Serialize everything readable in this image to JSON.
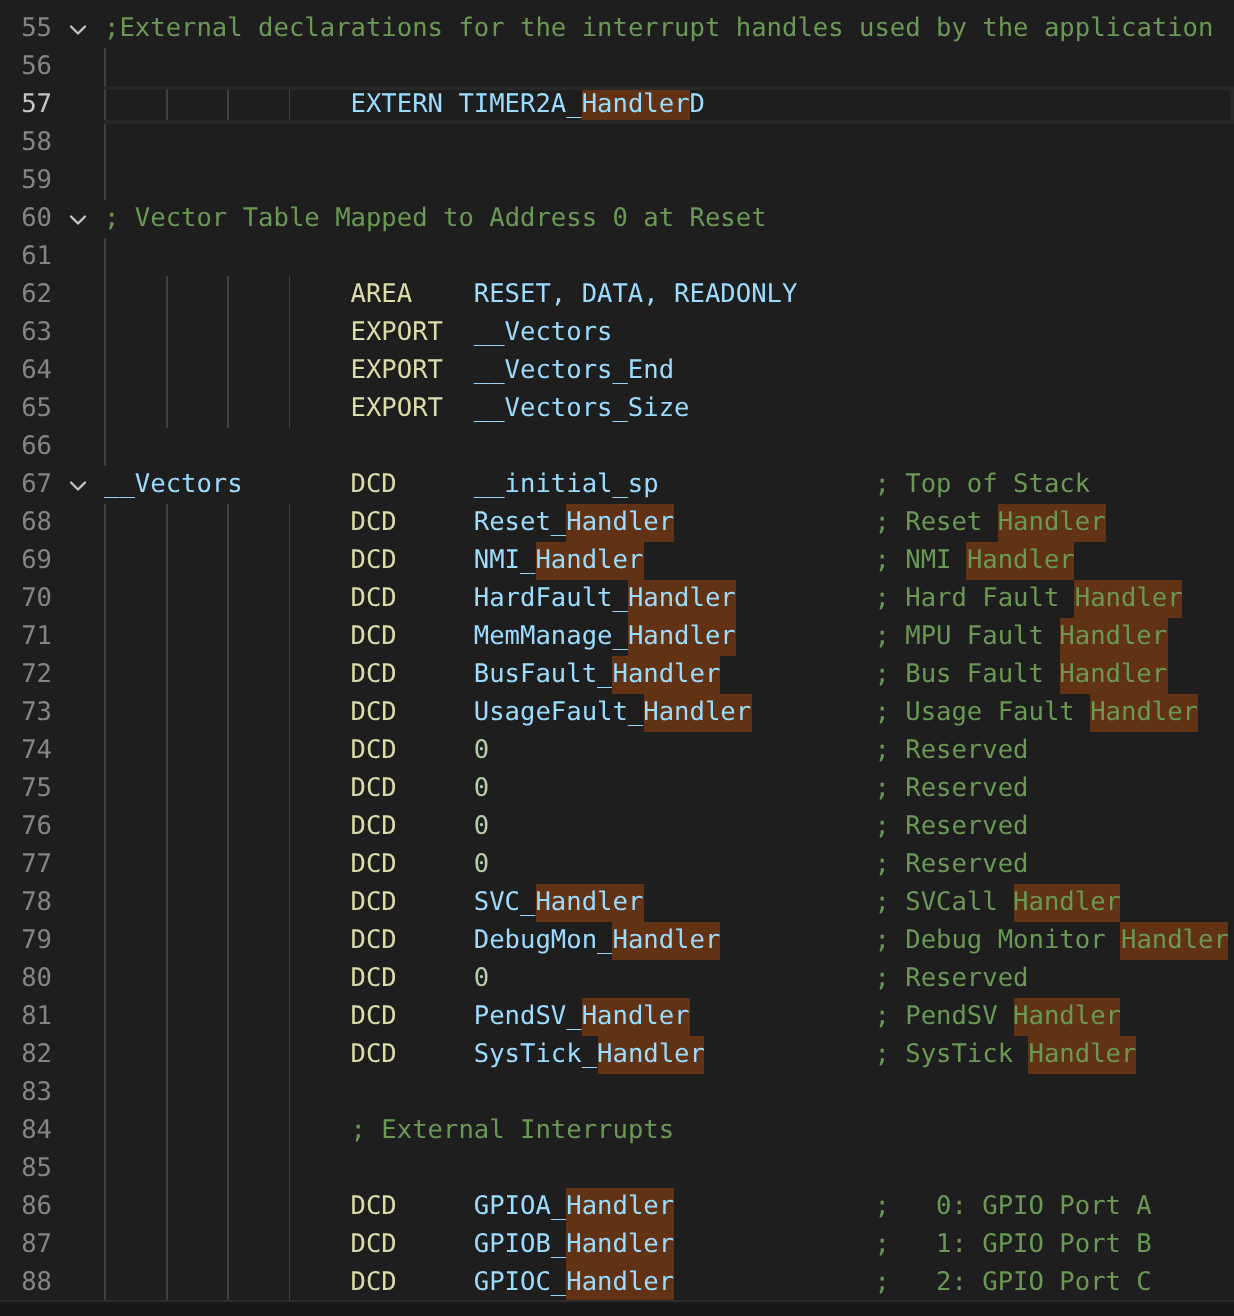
{
  "editor": {
    "lines": [
      {
        "number": "55",
        "fold": true,
        "current": false,
        "label": {
          "kind": "comment",
          "parts": [
            {
              "text": ";External declarations for the interrupt handles used by the application",
              "match": false
            }
          ]
        }
      },
      {
        "number": "56",
        "fold": false,
        "current": false
      },
      {
        "number": "57",
        "fold": false,
        "current": true,
        "op": {
          "kind": "identifier",
          "parts": [
            {
              "text": "EXTERN TIMER2A_",
              "match": false
            },
            {
              "text": "Handler",
              "match": true
            },
            {
              "text": "D",
              "match": false
            }
          ]
        }
      },
      {
        "number": "58",
        "fold": false,
        "current": false
      },
      {
        "number": "59",
        "fold": false,
        "current": false
      },
      {
        "number": "60",
        "fold": true,
        "current": false,
        "label": {
          "kind": "comment",
          "parts": [
            {
              "text": "; Vector Table Mapped to Address 0 at Reset",
              "match": false
            }
          ]
        }
      },
      {
        "number": "61",
        "fold": false,
        "current": false
      },
      {
        "number": "62",
        "fold": false,
        "current": false,
        "op": {
          "kind": "keyword",
          "parts": [
            {
              "text": "AREA",
              "match": false
            }
          ]
        },
        "arg": {
          "kind": "identifier",
          "parts": [
            {
              "text": "RESET, DATA, READONLY",
              "match": false
            }
          ]
        }
      },
      {
        "number": "63",
        "fold": false,
        "current": false,
        "op": {
          "kind": "keyword",
          "parts": [
            {
              "text": "EXPORT",
              "match": false
            }
          ]
        },
        "arg": {
          "kind": "identifier",
          "parts": [
            {
              "text": "__Vectors",
              "match": false
            }
          ]
        }
      },
      {
        "number": "64",
        "fold": false,
        "current": false,
        "op": {
          "kind": "keyword",
          "parts": [
            {
              "text": "EXPORT",
              "match": false
            }
          ]
        },
        "arg": {
          "kind": "identifier",
          "parts": [
            {
              "text": "__Vectors_End",
              "match": false
            }
          ]
        }
      },
      {
        "number": "65",
        "fold": false,
        "current": false,
        "op": {
          "kind": "keyword",
          "parts": [
            {
              "text": "EXPORT",
              "match": false
            }
          ]
        },
        "arg": {
          "kind": "identifier",
          "parts": [
            {
              "text": "__Vectors_Size",
              "match": false
            }
          ]
        }
      },
      {
        "number": "66",
        "fold": false,
        "current": false
      },
      {
        "number": "67",
        "fold": true,
        "current": false,
        "label": {
          "kind": "identifier",
          "parts": [
            {
              "text": "__Vectors",
              "match": false
            }
          ]
        },
        "op": {
          "kind": "keyword",
          "parts": [
            {
              "text": "DCD",
              "match": false
            }
          ]
        },
        "arg": {
          "kind": "identifier",
          "parts": [
            {
              "text": "__initial_sp",
              "match": false
            }
          ]
        },
        "note": {
          "kind": "comment",
          "parts": [
            {
              "text": "; Top of Stack",
              "match": false
            }
          ]
        }
      },
      {
        "number": "68",
        "fold": false,
        "current": false,
        "op": {
          "kind": "keyword",
          "parts": [
            {
              "text": "DCD",
              "match": false
            }
          ]
        },
        "arg": {
          "kind": "identifier",
          "parts": [
            {
              "text": "Reset_",
              "match": false
            },
            {
              "text": "Handler",
              "match": true
            }
          ]
        },
        "note": {
          "kind": "comment",
          "parts": [
            {
              "text": "; Reset ",
              "match": false
            },
            {
              "text": "Handler",
              "match": true
            }
          ]
        }
      },
      {
        "number": "69",
        "fold": false,
        "current": false,
        "op": {
          "kind": "keyword",
          "parts": [
            {
              "text": "DCD",
              "match": false
            }
          ]
        },
        "arg": {
          "kind": "identifier",
          "parts": [
            {
              "text": "NMI_",
              "match": false
            },
            {
              "text": "Handler",
              "match": true
            }
          ]
        },
        "note": {
          "kind": "comment",
          "parts": [
            {
              "text": "; NMI ",
              "match": false
            },
            {
              "text": "Handler",
              "match": true
            }
          ]
        }
      },
      {
        "number": "70",
        "fold": false,
        "current": false,
        "op": {
          "kind": "keyword",
          "parts": [
            {
              "text": "DCD",
              "match": false
            }
          ]
        },
        "arg": {
          "kind": "identifier",
          "parts": [
            {
              "text": "HardFault_",
              "match": false
            },
            {
              "text": "Handler",
              "match": true
            }
          ]
        },
        "note": {
          "kind": "comment",
          "parts": [
            {
              "text": "; Hard Fault ",
              "match": false
            },
            {
              "text": "Handler",
              "match": true
            }
          ]
        }
      },
      {
        "number": "71",
        "fold": false,
        "current": false,
        "op": {
          "kind": "keyword",
          "parts": [
            {
              "text": "DCD",
              "match": false
            }
          ]
        },
        "arg": {
          "kind": "identifier",
          "parts": [
            {
              "text": "MemManage_",
              "match": false
            },
            {
              "text": "Handler",
              "match": true
            }
          ]
        },
        "note": {
          "kind": "comment",
          "parts": [
            {
              "text": "; MPU Fault ",
              "match": false
            },
            {
              "text": "Handler",
              "match": true
            }
          ]
        }
      },
      {
        "number": "72",
        "fold": false,
        "current": false,
        "op": {
          "kind": "keyword",
          "parts": [
            {
              "text": "DCD",
              "match": false
            }
          ]
        },
        "arg": {
          "kind": "identifier",
          "parts": [
            {
              "text": "BusFault_",
              "match": false
            },
            {
              "text": "Handler",
              "match": true
            }
          ]
        },
        "note": {
          "kind": "comment",
          "parts": [
            {
              "text": "; Bus Fault ",
              "match": false
            },
            {
              "text": "Handler",
              "match": true
            }
          ]
        }
      },
      {
        "number": "73",
        "fold": false,
        "current": false,
        "op": {
          "kind": "keyword",
          "parts": [
            {
              "text": "DCD",
              "match": false
            }
          ]
        },
        "arg": {
          "kind": "identifier",
          "parts": [
            {
              "text": "UsageFault_",
              "match": false
            },
            {
              "text": "Handler",
              "match": true
            }
          ]
        },
        "note": {
          "kind": "comment",
          "parts": [
            {
              "text": "; Usage Fault ",
              "match": false
            },
            {
              "text": "Handler",
              "match": true
            }
          ]
        }
      },
      {
        "number": "74",
        "fold": false,
        "current": false,
        "op": {
          "kind": "keyword",
          "parts": [
            {
              "text": "DCD",
              "match": false
            }
          ]
        },
        "arg": {
          "kind": "number",
          "parts": [
            {
              "text": "0",
              "match": false
            }
          ]
        },
        "note": {
          "kind": "comment",
          "parts": [
            {
              "text": "; Reserved",
              "match": false
            }
          ]
        }
      },
      {
        "number": "75",
        "fold": false,
        "current": false,
        "op": {
          "kind": "keyword",
          "parts": [
            {
              "text": "DCD",
              "match": false
            }
          ]
        },
        "arg": {
          "kind": "number",
          "parts": [
            {
              "text": "0",
              "match": false
            }
          ]
        },
        "note": {
          "kind": "comment",
          "parts": [
            {
              "text": "; Reserved",
              "match": false
            }
          ]
        }
      },
      {
        "number": "76",
        "fold": false,
        "current": false,
        "op": {
          "kind": "keyword",
          "parts": [
            {
              "text": "DCD",
              "match": false
            }
          ]
        },
        "arg": {
          "kind": "number",
          "parts": [
            {
              "text": "0",
              "match": false
            }
          ]
        },
        "note": {
          "kind": "comment",
          "parts": [
            {
              "text": "; Reserved",
              "match": false
            }
          ]
        }
      },
      {
        "number": "77",
        "fold": false,
        "current": false,
        "op": {
          "kind": "keyword",
          "parts": [
            {
              "text": "DCD",
              "match": false
            }
          ]
        },
        "arg": {
          "kind": "number",
          "parts": [
            {
              "text": "0",
              "match": false
            }
          ]
        },
        "note": {
          "kind": "comment",
          "parts": [
            {
              "text": "; Reserved",
              "match": false
            }
          ]
        }
      },
      {
        "number": "78",
        "fold": false,
        "current": false,
        "op": {
          "kind": "keyword",
          "parts": [
            {
              "text": "DCD",
              "match": false
            }
          ]
        },
        "arg": {
          "kind": "identifier",
          "parts": [
            {
              "text": "SVC_",
              "match": false
            },
            {
              "text": "Handler",
              "match": true
            }
          ]
        },
        "note": {
          "kind": "comment",
          "parts": [
            {
              "text": "; SVCall ",
              "match": false
            },
            {
              "text": "Handler",
              "match": true
            }
          ]
        }
      },
      {
        "number": "79",
        "fold": false,
        "current": false,
        "op": {
          "kind": "keyword",
          "parts": [
            {
              "text": "DCD",
              "match": false
            }
          ]
        },
        "arg": {
          "kind": "identifier",
          "parts": [
            {
              "text": "DebugMon_",
              "match": false
            },
            {
              "text": "Handler",
              "match": true
            }
          ]
        },
        "note": {
          "kind": "comment",
          "parts": [
            {
              "text": "; Debug Monitor ",
              "match": false
            },
            {
              "text": "Handler",
              "match": true
            }
          ]
        }
      },
      {
        "number": "80",
        "fold": false,
        "current": false,
        "op": {
          "kind": "keyword",
          "parts": [
            {
              "text": "DCD",
              "match": false
            }
          ]
        },
        "arg": {
          "kind": "number",
          "parts": [
            {
              "text": "0",
              "match": false
            }
          ]
        },
        "note": {
          "kind": "comment",
          "parts": [
            {
              "text": "; Reserved",
              "match": false
            }
          ]
        }
      },
      {
        "number": "81",
        "fold": false,
        "current": false,
        "op": {
          "kind": "keyword",
          "parts": [
            {
              "text": "DCD",
              "match": false
            }
          ]
        },
        "arg": {
          "kind": "identifier",
          "parts": [
            {
              "text": "PendSV_",
              "match": false
            },
            {
              "text": "Handler",
              "match": true
            }
          ]
        },
        "note": {
          "kind": "comment",
          "parts": [
            {
              "text": "; PendSV ",
              "match": false
            },
            {
              "text": "Handler",
              "match": true
            }
          ]
        }
      },
      {
        "number": "82",
        "fold": false,
        "current": false,
        "op": {
          "kind": "keyword",
          "parts": [
            {
              "text": "DCD",
              "match": false
            }
          ]
        },
        "arg": {
          "kind": "identifier",
          "parts": [
            {
              "text": "SysTick_",
              "match": false
            },
            {
              "text": "Handler",
              "match": true
            }
          ]
        },
        "note": {
          "kind": "comment",
          "parts": [
            {
              "text": "; SysTick ",
              "match": false
            },
            {
              "text": "Handler",
              "match": true
            }
          ]
        }
      },
      {
        "number": "83",
        "fold": false,
        "current": false
      },
      {
        "number": "84",
        "fold": false,
        "current": false,
        "op": {
          "kind": "comment",
          "parts": [
            {
              "text": "; External Interrupts",
              "match": false
            }
          ]
        }
      },
      {
        "number": "85",
        "fold": false,
        "current": false
      },
      {
        "number": "86",
        "fold": false,
        "current": false,
        "op": {
          "kind": "keyword",
          "parts": [
            {
              "text": "DCD",
              "match": false
            }
          ]
        },
        "arg": {
          "kind": "identifier",
          "parts": [
            {
              "text": "GPIOA_",
              "match": false
            },
            {
              "text": "Handler",
              "match": true
            }
          ]
        },
        "note": {
          "kind": "comment",
          "parts": [
            {
              "text": ";   0: GPIO Port A",
              "match": false
            }
          ]
        }
      },
      {
        "number": "87",
        "fold": false,
        "current": false,
        "op": {
          "kind": "keyword",
          "parts": [
            {
              "text": "DCD",
              "match": false
            }
          ]
        },
        "arg": {
          "kind": "identifier",
          "parts": [
            {
              "text": "GPIOB_",
              "match": false
            },
            {
              "text": "Handler",
              "match": true
            }
          ]
        },
        "note": {
          "kind": "comment",
          "parts": [
            {
              "text": ";   1: GPIO Port B",
              "match": false
            }
          ]
        }
      },
      {
        "number": "88",
        "fold": false,
        "current": false,
        "op": {
          "kind": "keyword",
          "parts": [
            {
              "text": "DCD",
              "match": false
            }
          ]
        },
        "arg": {
          "kind": "identifier",
          "parts": [
            {
              "text": "GPIOC_",
              "match": false
            },
            {
              "text": "Handler",
              "match": true
            }
          ]
        },
        "note": {
          "kind": "comment",
          "parts": [
            {
              "text": ";   2: GPIO Port C",
              "match": false
            }
          ]
        }
      }
    ]
  }
}
